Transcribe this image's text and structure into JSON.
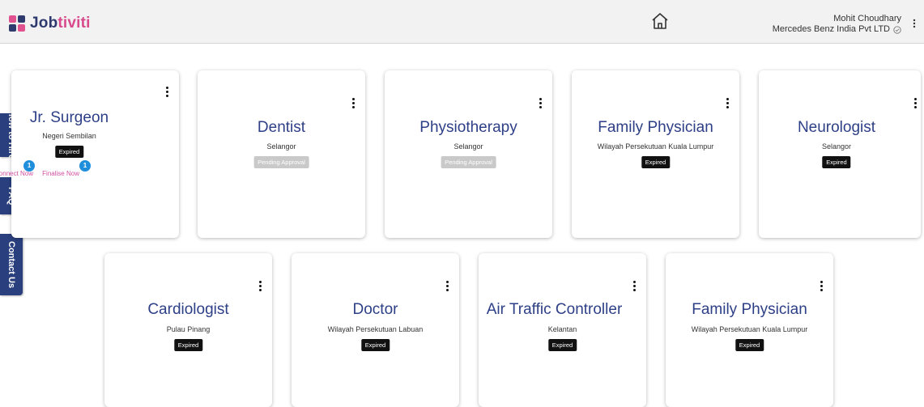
{
  "brand": {
    "name_main": "Job",
    "name_accent": "tiviti"
  },
  "header": {
    "user_name": "Mohit Choudhary",
    "company": "Mercedes Benz India Pvt LTD"
  },
  "side_tabs": [
    "How to Hire",
    "FAQ",
    "Contact Us"
  ],
  "jobs": [
    {
      "title": "Jr. Surgeon",
      "location": "Negeri Sembilan",
      "status": "Expired",
      "connect_label": "Connect Now",
      "connect_count": "1",
      "finalise_label": "Finalise Now",
      "finalise_count": "1"
    },
    {
      "title": "Dentist",
      "location": "Selangor",
      "status": "Pending Approval"
    },
    {
      "title": "Physiotherapy",
      "location": "Selangor",
      "status": "Pending Approval"
    },
    {
      "title": "Family Physician",
      "location": "Wilayah Persekutuan Kuala Lumpur",
      "status": "Expired"
    },
    {
      "title": "Neurologist",
      "location": "Selangor",
      "status": "Expired"
    },
    {
      "title": "Cardiologist",
      "location": "Pulau Pinang",
      "status": "Expired"
    },
    {
      "title": "Doctor",
      "location": "Wilayah Persekutuan Labuan",
      "status": "Expired"
    },
    {
      "title": "Air Traffic Controller",
      "location": "Kelantan",
      "status": "Expired"
    },
    {
      "title": "Family Physician",
      "location": "Wilayah Persekutuan Kuala Lumpur",
      "status": "Expired"
    }
  ],
  "colors": {
    "primary": "#2d3f86",
    "accent": "#d84a8c",
    "badge_expired": "#111111",
    "badge_pending": "#c9c9c9",
    "notify": "#1f8fdc"
  },
  "icons": {
    "home": "home-icon",
    "user_menu": "kebab-menu-icon",
    "verified": "check-circle-icon"
  }
}
